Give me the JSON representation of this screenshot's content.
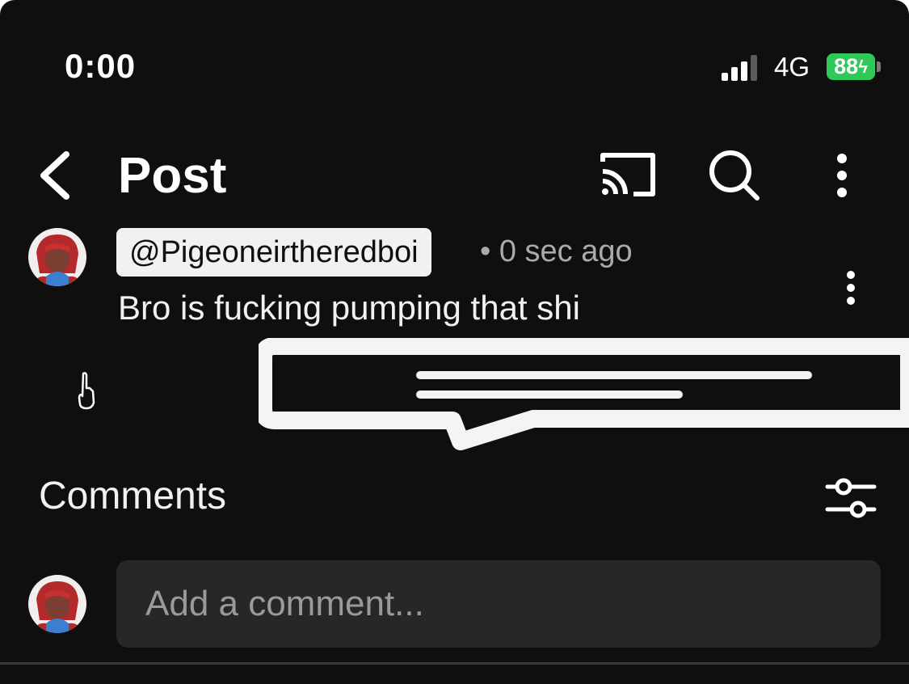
{
  "status_bar": {
    "time": "0:00",
    "network": "4G",
    "battery": "88"
  },
  "header": {
    "title": "Post"
  },
  "post": {
    "handle": "@Pigeoneirtheredboi",
    "time_ago": "• 0 sec ago",
    "text": "Bro is fucking pumping that shi"
  },
  "comments": {
    "title": "Comments",
    "input_placeholder": "Add a comment..."
  },
  "icons": {
    "back": "chevron-left-icon",
    "cast": "cast-icon",
    "search": "search-icon",
    "more": "more-vertical-icon",
    "filter": "sliders-icon"
  },
  "colors": {
    "background": "#0f0f0f",
    "battery": "#31c85a",
    "input": "#272727"
  }
}
